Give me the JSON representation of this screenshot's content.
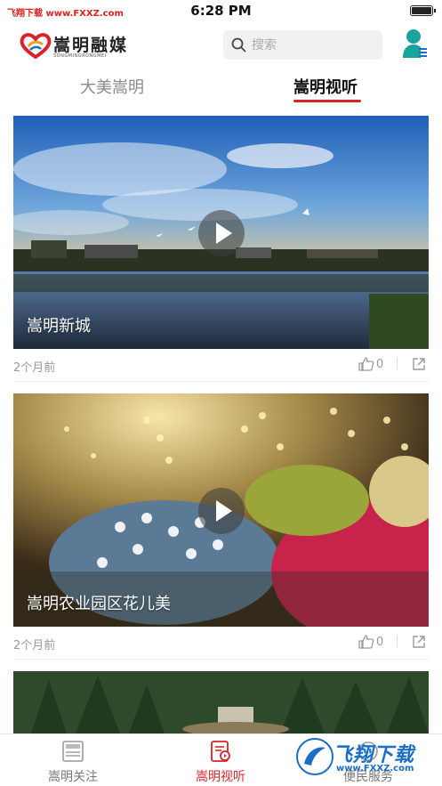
{
  "status_bar": {
    "carrier": "飞翔下载 www.FXXZ.com",
    "time": "6:28 PM"
  },
  "header": {
    "logo_text": "嵩明融媒",
    "logo_subtext": "SONGMINGRONGMEI",
    "search_placeholder": "搜索",
    "icons": {
      "search": "search-icon",
      "user": "user-icon"
    }
  },
  "tabs": [
    {
      "label": "大美嵩明",
      "active": false
    },
    {
      "label": "嵩明视听",
      "active": true
    }
  ],
  "feed": [
    {
      "title": "嵩明新城",
      "time": "2个月前",
      "likes": "0",
      "scene": "lake-skyline"
    },
    {
      "title": "嵩明农业园区花儿美",
      "time": "2个月前",
      "likes": "0",
      "scene": "flower-garden"
    },
    {
      "title": "",
      "time": "",
      "likes": "",
      "scene": "forest"
    }
  ],
  "bottom_nav": [
    {
      "label": "嵩明关注",
      "icon": "news-icon",
      "active": false
    },
    {
      "label": "嵩明视听",
      "icon": "media-icon",
      "active": true
    },
    {
      "label": "便民服务",
      "icon": "service-icon",
      "active": false
    }
  ],
  "watermark": {
    "text": "飞翔下载",
    "url": "www.FXXZ.com"
  },
  "colors": {
    "accent": "#d8232a",
    "user_icon": "#1aa39a",
    "watermark": "#1a6fc4"
  }
}
